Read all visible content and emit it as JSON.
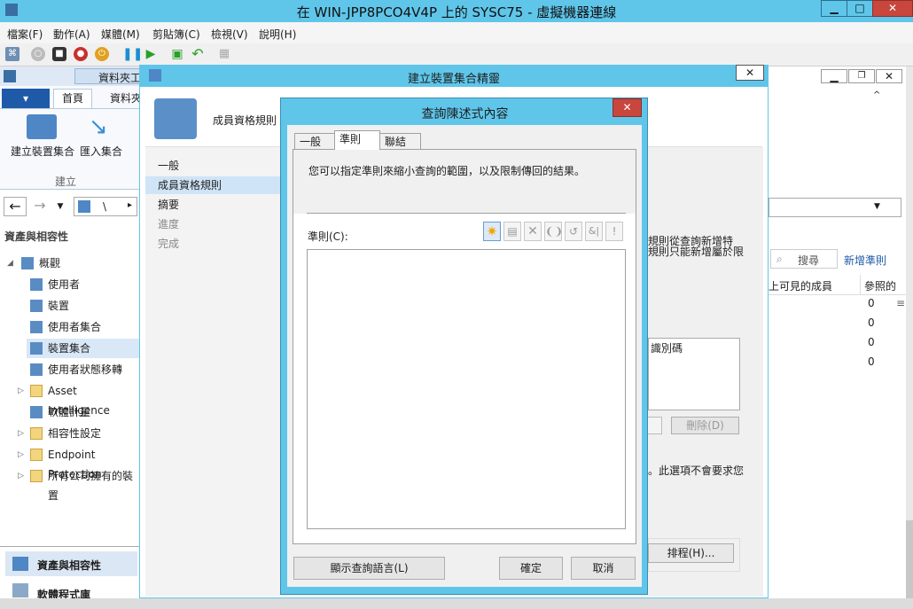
{
  "vm": {
    "title": "在 WIN-JPP8PCO4V4P 上的 SYSC75 - 虛擬機器連線",
    "menu": [
      "檔案(F)",
      "動作(A)",
      "媒體(M)",
      "剪貼簿(C)",
      "檢視(V)",
      "說明(H)"
    ]
  },
  "console": {
    "tab_folder": "資料夾工",
    "ribbon_tabs": [
      "首頁",
      "資料夾"
    ],
    "ribbon_buttons": [
      "建立裝置集合",
      "匯入集合"
    ],
    "ribbon_group": "建立",
    "nav_path": "\\",
    "nav_header": "資產與相容性",
    "tree": [
      {
        "label": "概觀",
        "indent": 0
      },
      {
        "label": "使用者",
        "indent": 1
      },
      {
        "label": "裝置",
        "indent": 1
      },
      {
        "label": "使用者集合",
        "indent": 1
      },
      {
        "label": "裝置集合",
        "indent": 1,
        "selected": true
      },
      {
        "label": "使用者狀態移轉",
        "indent": 1
      },
      {
        "label": "Asset Intelligence",
        "indent": 1,
        "folder": true
      },
      {
        "label": "軟體計量",
        "indent": 1
      },
      {
        "label": "相容性設定",
        "indent": 1,
        "folder": true
      },
      {
        "label": "Endpoint Protection",
        "indent": 1,
        "folder": true
      },
      {
        "label": "所有公司擁有的裝置",
        "indent": 1,
        "folder": true
      }
    ],
    "workspaces": [
      "資產與相容性",
      "軟體程式庫"
    ],
    "right": {
      "search": "搜尋",
      "add_criteria": "新增準則",
      "col1": "上可見的成員",
      "col2": "參照的",
      "rows": [
        "0",
        "0",
        "0",
        "0"
      ]
    }
  },
  "wizard": {
    "title": "建立裝置集合精靈",
    "header": "成員資格規則",
    "steps": [
      "一般",
      "成員資格規則",
      "摘要",
      "進度",
      "完成"
    ],
    "active_step": 1,
    "frag1": "規則從查詢新增特",
    "frag2": "規則只能新增屬於限",
    "list_header": "識別碼",
    "delete_btn": "刪除(D)",
    "note": "。此選項不會要求您",
    "schedule_btn": "排程(H)..."
  },
  "dialog": {
    "title": "查詢陳述式內容",
    "tabs": [
      "一般",
      "準則",
      "聯結"
    ],
    "active_tab": 1,
    "description": "您可以指定準則來縮小查詢的範圍，以及限制傳回的結果。",
    "criteria_label": "準則(C):",
    "criteria_icons": [
      "new-criteria-icon",
      "properties-icon",
      "delete-icon",
      "group-icon",
      "ungroup-icon",
      "and-or-icon",
      "not-icon"
    ],
    "show_query_btn": "顯示查詢語言(L)",
    "ok_btn": "確定",
    "cancel_btn": "取消"
  }
}
